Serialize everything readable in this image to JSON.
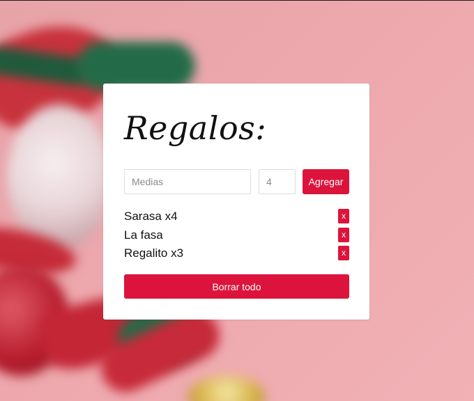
{
  "card": {
    "title": "Regalos:"
  },
  "form": {
    "name_placeholder": "Medias",
    "qty_placeholder": "4",
    "add_label": "Agregar"
  },
  "gifts": [
    {
      "label": "Sarasa x4",
      "delete_label": "x"
    },
    {
      "label": "La fasa",
      "delete_label": "x"
    },
    {
      "label": "Regalito x3",
      "delete_label": "x"
    }
  ],
  "clear_label": "Borrar todo",
  "colors": {
    "accent": "#dc143c",
    "card": "#ffffff",
    "background": "#eda8ad"
  }
}
